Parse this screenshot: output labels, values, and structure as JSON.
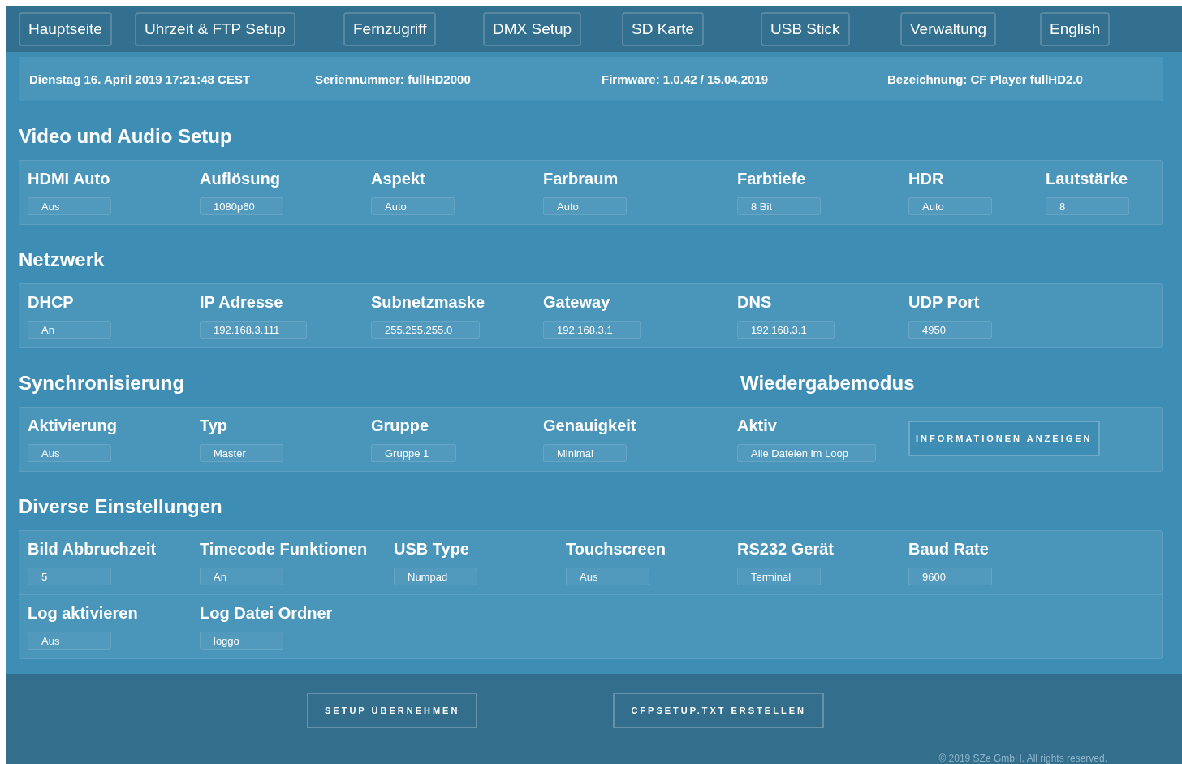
{
  "nav": [
    {
      "label": "Hauptseite"
    },
    {
      "label": "Uhrzeit & FTP Setup"
    },
    {
      "label": "Fernzugriff"
    },
    {
      "label": "DMX Setup"
    },
    {
      "label": "SD Karte"
    },
    {
      "label": "USB Stick"
    },
    {
      "label": "Verwaltung"
    },
    {
      "label": "English"
    }
  ],
  "info": [
    "Dienstag 16. April 2019 17:21:48 CEST",
    "Seriennummer: fullHD2000",
    "Firmware: 1.0.42 / 15.04.2019",
    "Bezeichnung: CF Player fullHD2.0"
  ],
  "sections": [
    {
      "titles": [
        "Video und Audio Setup"
      ],
      "rows": [
        [
          {
            "kind": "field",
            "label": "HDMI Auto",
            "value": "Aus"
          },
          {
            "kind": "field",
            "label": "Auflösung",
            "value": "1080p60"
          },
          {
            "kind": "field",
            "label": "Aspekt",
            "value": "Auto"
          },
          {
            "kind": "field",
            "label": "Farbraum",
            "value": "Auto"
          },
          {
            "kind": "field",
            "label": "Farbtiefe",
            "value": "8 Bit"
          },
          {
            "kind": "field",
            "label": "HDR",
            "value": "Auto"
          },
          {
            "kind": "field",
            "label": "Lautstärke",
            "value": "8"
          }
        ]
      ]
    },
    {
      "titles": [
        "Netzwerk"
      ],
      "rows": [
        [
          {
            "kind": "field",
            "label": "DHCP",
            "value": "An"
          },
          {
            "kind": "field",
            "label": "IP Adresse",
            "value": "192.168.3.111"
          },
          {
            "kind": "field",
            "label": "Subnetzmaske",
            "value": "255.255.255.0"
          },
          {
            "kind": "field",
            "label": "Gateway",
            "value": "192.168.3.1"
          },
          {
            "kind": "field",
            "label": "DNS",
            "value": "192.168.3.1"
          },
          {
            "kind": "field",
            "label": "UDP Port",
            "value": "4950"
          }
        ]
      ]
    },
    {
      "titles": [
        "Synchronisierung",
        "Wiedergabemodus"
      ],
      "rows": [
        [
          {
            "kind": "field",
            "label": "Aktivierung",
            "value": "Aus"
          },
          {
            "kind": "field",
            "label": "Typ",
            "value": "Master"
          },
          {
            "kind": "field",
            "label": "Gruppe",
            "value": "Gruppe 1"
          },
          {
            "kind": "field",
            "label": "Genauigkeit",
            "value": "Minimal"
          },
          {
            "kind": "field",
            "label": "Aktiv",
            "value": "Alle Dateien im Loop"
          },
          {
            "kind": "button",
            "label": "INFORMATIONEN ANZEIGEN"
          }
        ]
      ]
    },
    {
      "titles": [
        "Diverse Einstellungen"
      ],
      "rows": [
        [
          {
            "kind": "field",
            "label": "Bild Abbruchzeit",
            "value": "5"
          },
          {
            "kind": "field",
            "label": "Timecode Funktionen",
            "value": "An"
          },
          {
            "kind": "field",
            "label": "USB Type",
            "value": "Numpad"
          },
          {
            "kind": "field",
            "label": "Touchscreen",
            "value": "Aus"
          },
          {
            "kind": "field",
            "label": "RS232 Gerät",
            "value": "Terminal"
          },
          {
            "kind": "field",
            "label": "Baud Rate",
            "value": "9600"
          }
        ],
        [
          {
            "kind": "field",
            "label": "Log aktivieren",
            "value": "Aus"
          },
          {
            "kind": "field",
            "label": "Log Datei Ordner",
            "value": "loggo"
          }
        ]
      ]
    }
  ],
  "footer_buttons": [
    "SETUP ÜBERNEHMEN",
    "CFPSETUP.TXT ERSTELLEN"
  ],
  "copyright": "© 2019 SZe GmbH. All rights reserved."
}
